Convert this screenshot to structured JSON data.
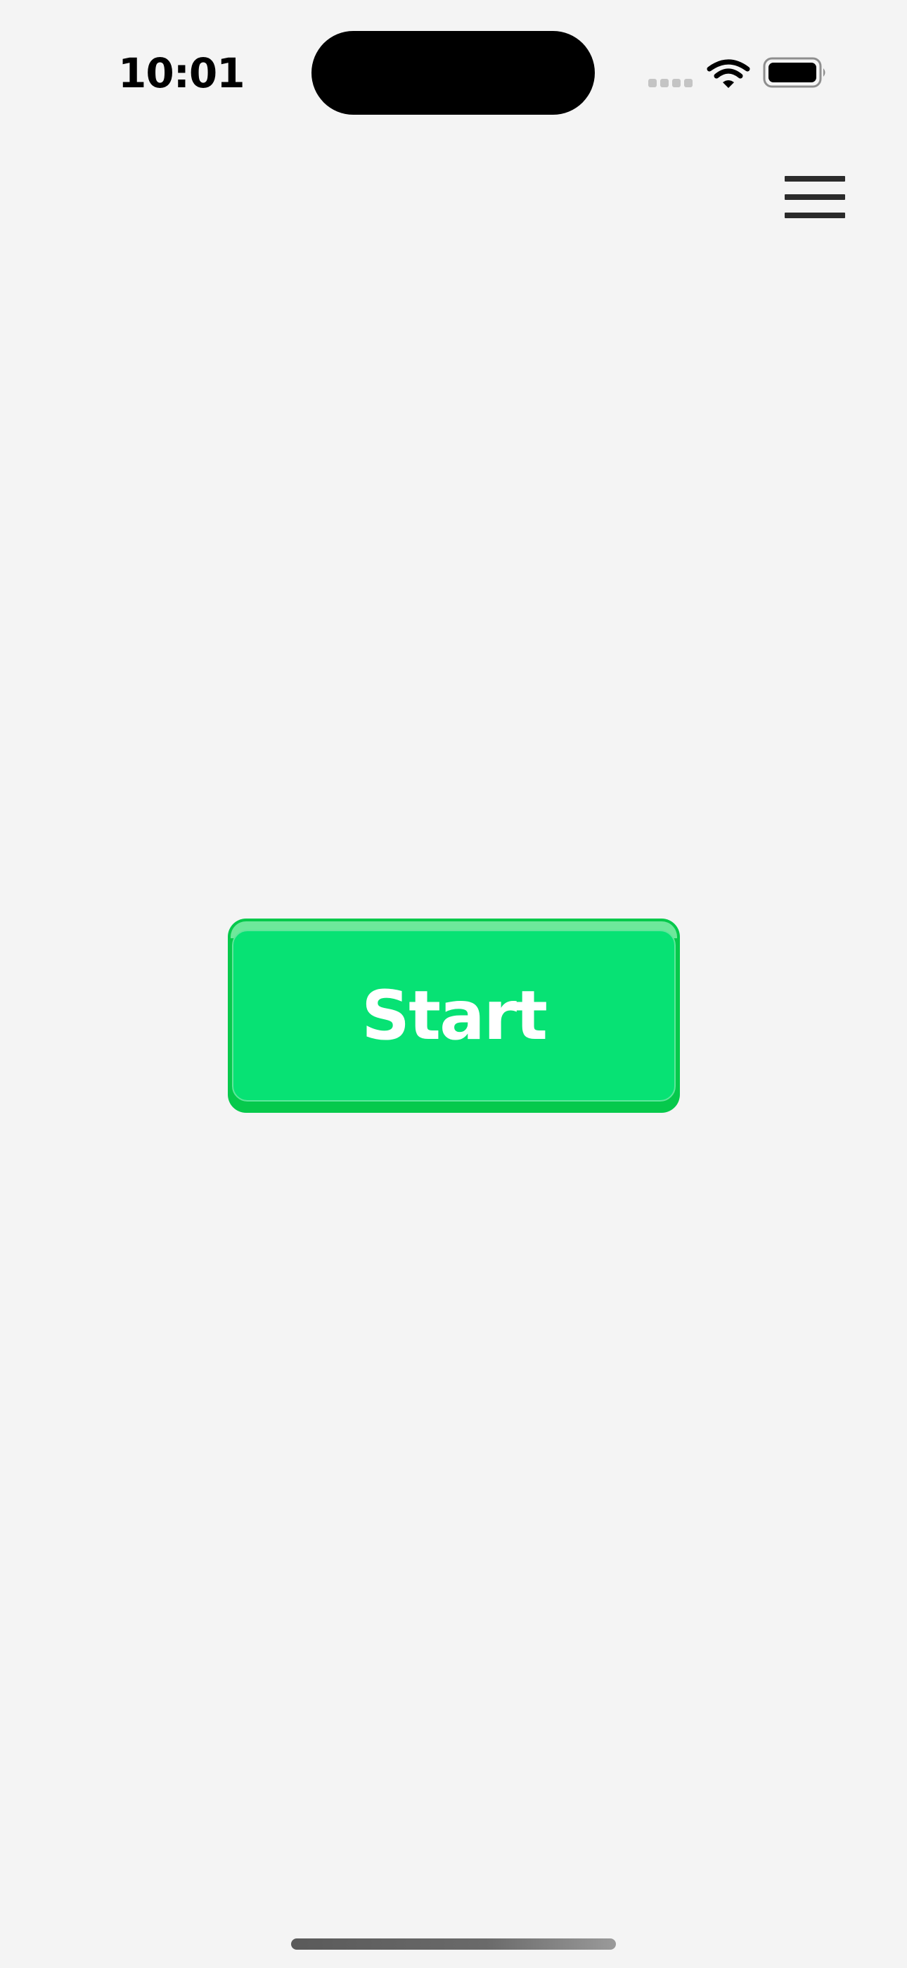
{
  "status_bar": {
    "time": "10:01",
    "icons": [
      "signal-icon",
      "wifi-icon",
      "battery-icon"
    ]
  },
  "header": {
    "menu_icon": "hamburger-menu-icon"
  },
  "main": {
    "start_label": "Start"
  },
  "colors": {
    "background": "#f4f4f4",
    "button_face": "#07e274",
    "button_base": "#06c94c",
    "button_text": "#ffffff"
  }
}
